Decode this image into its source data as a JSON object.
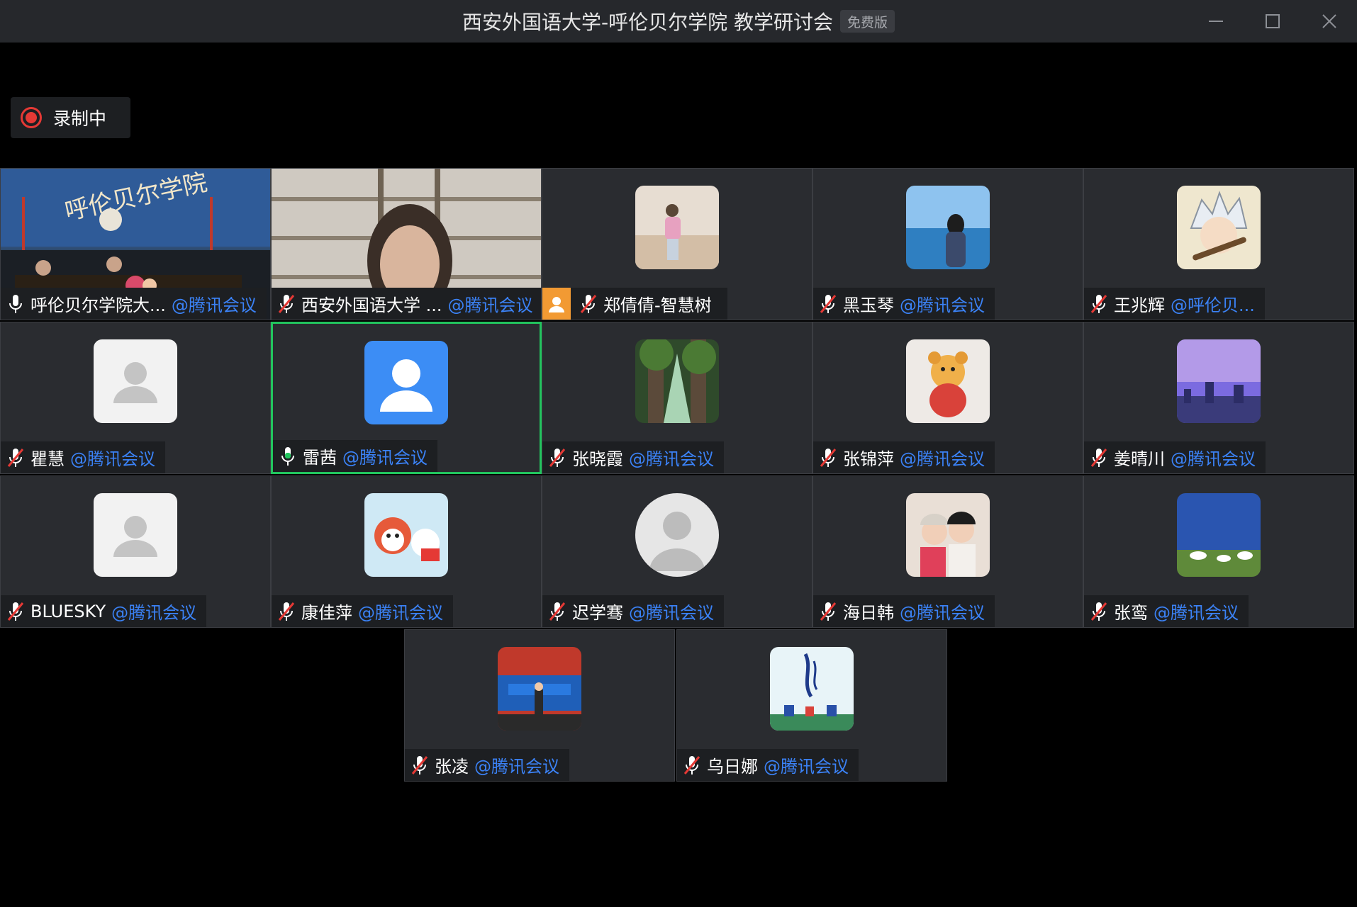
{
  "window": {
    "title": "西安外国语大学-呼伦贝尔学院  教学研讨会",
    "badge": "免费版"
  },
  "recording": {
    "label": "录制中",
    "color": "#e53935"
  },
  "colors": {
    "accent_tag": "#3b82f6",
    "active_speaker": "#22c55e",
    "mic_on": "#22c55e",
    "mic_muted": "#e53935"
  },
  "participants": [
    {
      "name": "呼伦贝尔学院大...",
      "tag": "@腾讯会议",
      "mic": "on",
      "kind": "video"
    },
    {
      "name": "西安外国语大学 ...",
      "tag": "@腾讯会议",
      "mic": "muted",
      "kind": "video"
    },
    {
      "name": "郑倩倩-智慧树",
      "tag": "",
      "mic": "muted",
      "kind": "avatar",
      "host_icon": "user-badge-icon"
    },
    {
      "name": "黑玉琴",
      "tag": "@腾讯会议",
      "mic": "muted",
      "kind": "avatar"
    },
    {
      "name": "王兆辉",
      "tag": "@呼伦贝...",
      "mic": "muted",
      "kind": "avatar"
    },
    {
      "name": "瞿慧",
      "tag": "@腾讯会议",
      "mic": "muted",
      "kind": "avatar"
    },
    {
      "name": "雷茜",
      "tag": "@腾讯会议",
      "mic": "on",
      "kind": "avatar",
      "active": true
    },
    {
      "name": "张晓霞",
      "tag": "@腾讯会议",
      "mic": "muted",
      "kind": "avatar"
    },
    {
      "name": "张锦萍",
      "tag": "@腾讯会议",
      "mic": "muted",
      "kind": "avatar"
    },
    {
      "name": "姜晴川",
      "tag": "@腾讯会议",
      "mic": "muted",
      "kind": "avatar"
    },
    {
      "name": "BLUESKY",
      "tag": "@腾讯会议",
      "mic": "muted",
      "kind": "avatar"
    },
    {
      "name": "康佳萍",
      "tag": "@腾讯会议",
      "mic": "muted",
      "kind": "avatar"
    },
    {
      "name": "迟学骞",
      "tag": "@腾讯会议",
      "mic": "muted",
      "kind": "avatar"
    },
    {
      "name": "海日韩",
      "tag": "@腾讯会议",
      "mic": "muted",
      "kind": "avatar"
    },
    {
      "name": "张鸾",
      "tag": "@腾讯会议",
      "mic": "muted",
      "kind": "avatar"
    },
    {
      "name": "张凌",
      "tag": "@腾讯会议",
      "mic": "muted",
      "kind": "avatar"
    },
    {
      "name": "乌日娜",
      "tag": "@腾讯会议",
      "mic": "muted",
      "kind": "avatar"
    }
  ]
}
